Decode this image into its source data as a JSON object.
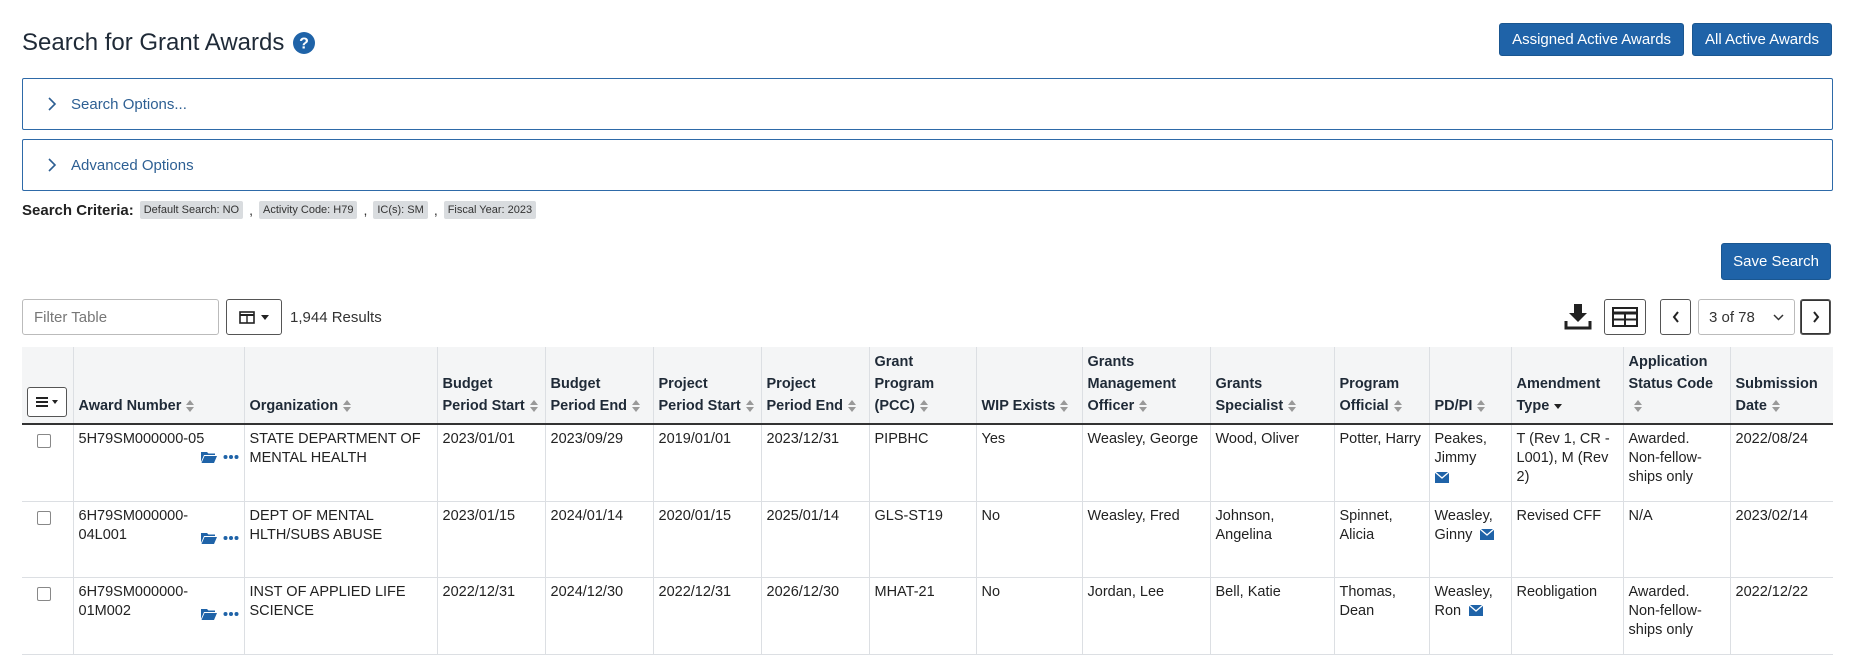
{
  "header": {
    "title": "Search for Grant Awards",
    "buttons": {
      "assigned": "Assigned Active Awards",
      "all": "All Active Awards"
    }
  },
  "accordions": {
    "search_options": "Search Options...",
    "advanced_options": "Advanced Options"
  },
  "criteria": {
    "label": "Search Criteria:",
    "chips": [
      "Default Search: NO",
      "Activity Code: H79",
      "IC(s): SM",
      "Fiscal Year: 2023"
    ]
  },
  "toolbar": {
    "save_search": "Save Search",
    "filter_placeholder": "Filter Table",
    "results": "1,944 Results",
    "page": "3 of 78"
  },
  "table": {
    "headers": [
      "Award Number",
      "Organization",
      "Budget Period Start",
      "Budget Period End",
      "Project Period Start",
      "Project Period End",
      "Grant Program (PCC)",
      "WIP Exists",
      "Grants Management Officer",
      "Grants Specialist",
      "Program Official",
      "PD/PI",
      "Amendment Type",
      "Application Status Code",
      "Submission Date"
    ],
    "rows": [
      {
        "award": "5H79SM000000-05",
        "org": "STATE DEPARTMENT OF MENTAL HEALTH",
        "bps": "2023/01/01",
        "bpe": "2023/09/29",
        "pps": "2019/01/01",
        "ppe": "2023/12/31",
        "pcc": "PIPBHC",
        "wip": "Yes",
        "gmo": "Weasley, George",
        "gs": "Wood, Oliver",
        "po": "Potter, Harry",
        "pdpi": "Peakes, Jimmy",
        "amend": "T (Rev 1, CR - L001), M (Rev 2)",
        "status": "Awarded. Non-fellow-ships only",
        "sub": "2022/08/24"
      },
      {
        "award": "6H79SM000000-04L001",
        "org": "DEPT OF MENTAL HLTH/SUBS ABUSE",
        "bps": "2023/01/15",
        "bpe": "2024/01/14",
        "pps": "2020/01/15",
        "ppe": "2025/01/14",
        "pcc": "GLS-ST19",
        "wip": "No",
        "gmo": "Weasley, Fred",
        "gs": "Johnson, Angelina",
        "po": "Spinnet, Alicia",
        "pdpi": "Weasley, Ginny",
        "amend": "Revised CFF",
        "status": "N/A",
        "sub": "2023/02/14"
      },
      {
        "award": "6H79SM000000-01M002",
        "org": "INST OF APPLIED LIFE SCIENCE",
        "bps": "2022/12/31",
        "bpe": "2024/12/30",
        "pps": "2022/12/31",
        "ppe": "2026/12/30",
        "pcc": "MHAT-21",
        "wip": "No",
        "gmo": "Jordan, Lee",
        "gs": "Bell, Katie",
        "po": "Thomas, Dean",
        "pdpi": "Weasley, Ron",
        "amend": "Reobligation",
        "status": "Awarded. Non-fellow-ships only",
        "sub": "2022/12/22"
      }
    ]
  },
  "icons": {
    "help": "question-circle-icon",
    "chevron": "chevron-right-icon",
    "folder": "folder-open-icon",
    "more": "ellipsis-icon",
    "mail": "envelope-icon",
    "download": "download-icon",
    "grid": "table-grid-icon"
  },
  "colors": {
    "primary": "#1f63a8",
    "accordion_text": "#2d5f93",
    "header_bg": "#f4f5f6"
  }
}
